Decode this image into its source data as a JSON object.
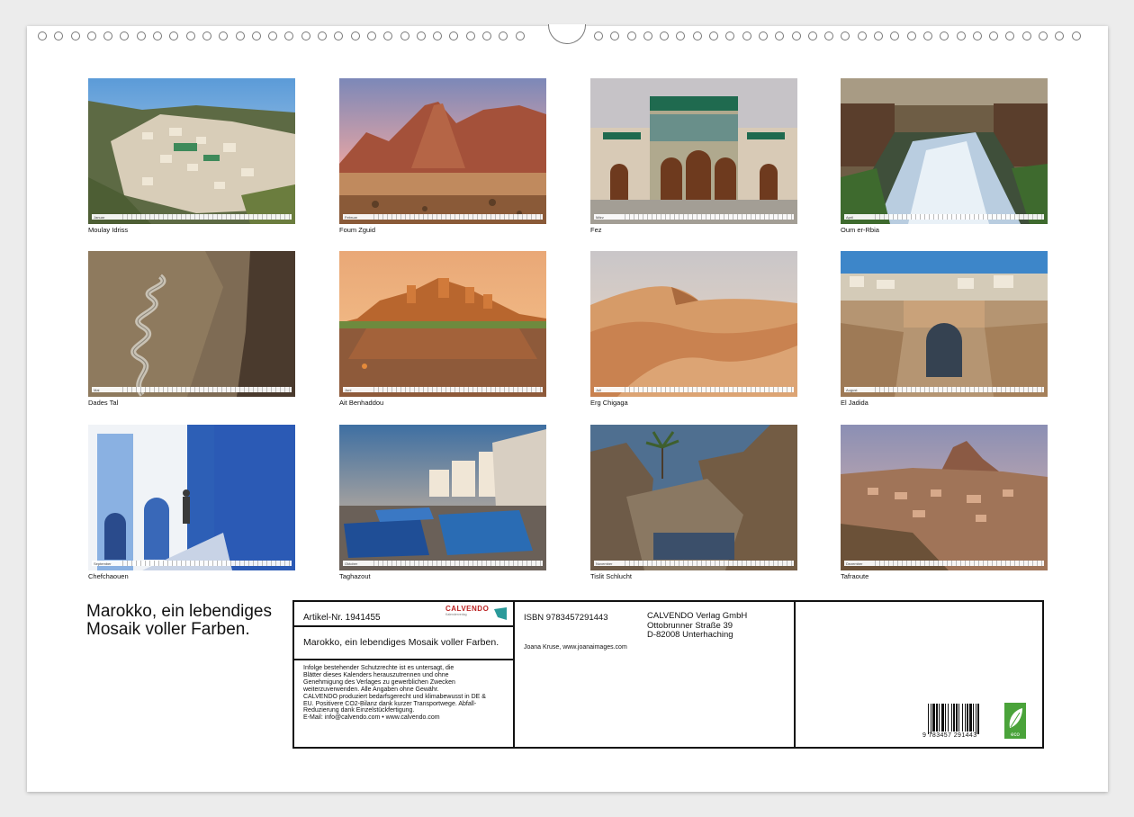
{
  "calendar": {
    "photos": [
      {
        "caption": "Moulay Idriss",
        "month": "Januar",
        "scene": "village"
      },
      {
        "caption": "Foum Zguid",
        "month": "Februar",
        "scene": "mountain"
      },
      {
        "caption": "Fez",
        "month": "März",
        "scene": "palace"
      },
      {
        "caption": "Oum er-Rbia",
        "month": "April",
        "scene": "waterfall"
      },
      {
        "caption": "Dades Tal",
        "month": "Mai",
        "scene": "serpentine"
      },
      {
        "caption": "Ait Benhaddou",
        "month": "Juni",
        "scene": "kasbah"
      },
      {
        "caption": "Erg Chigaga",
        "month": "Juli",
        "scene": "dunes"
      },
      {
        "caption": "El Jadida",
        "month": "August",
        "scene": "bridge"
      },
      {
        "caption": "Chefchaouen",
        "month": "September",
        "scene": "blue-alley"
      },
      {
        "caption": "Taghazout",
        "month": "Oktober",
        "scene": "boats"
      },
      {
        "caption": "Tislit Schlucht",
        "month": "November",
        "scene": "gorge"
      },
      {
        "caption": "Tafraoute",
        "month": "Dezember",
        "scene": "rock-village"
      }
    ],
    "title": "Marokko, ein lebendiges Mosaik voller Farben.",
    "info": {
      "article": "Artikel-Nr. 1941455",
      "logo_text": "CALVENDO",
      "logo_tagline": "Kalenderverlag",
      "product_title": "Marokko, ein lebendiges Mosaik voller Farben.",
      "legal_lines": [
        "Infolge bestehender Schutzrechte ist es untersagt, die",
        "Blätter dieses Kalenders herauszutrennen und ohne",
        "Genehmigung des Verlages zu gewerblichen Zwecken",
        "weiterzuverwenden. Alle Angaben ohne Gewähr.",
        "CALVENDO produziert bedarfsgerecht und klimabewusst in DE &",
        "EU. Positivere CO2-Bilanz dank kurzer Transportwege. Abfall-",
        "Reduzierung dank Einzelstückfertigung.",
        "E-Mail: info@calvendo.com • www.calvendo.com"
      ],
      "isbn": "ISBN 9783457291443",
      "publisher_lines": [
        "CALVENDO Verlag GmbH",
        "Ottobrunner Straße 39",
        "D-82008 Unterhaching"
      ],
      "author": "Joana Kruse, www.joanaimages.com",
      "barcode_number": "9 783457 291443",
      "eco_label": "eco"
    }
  }
}
